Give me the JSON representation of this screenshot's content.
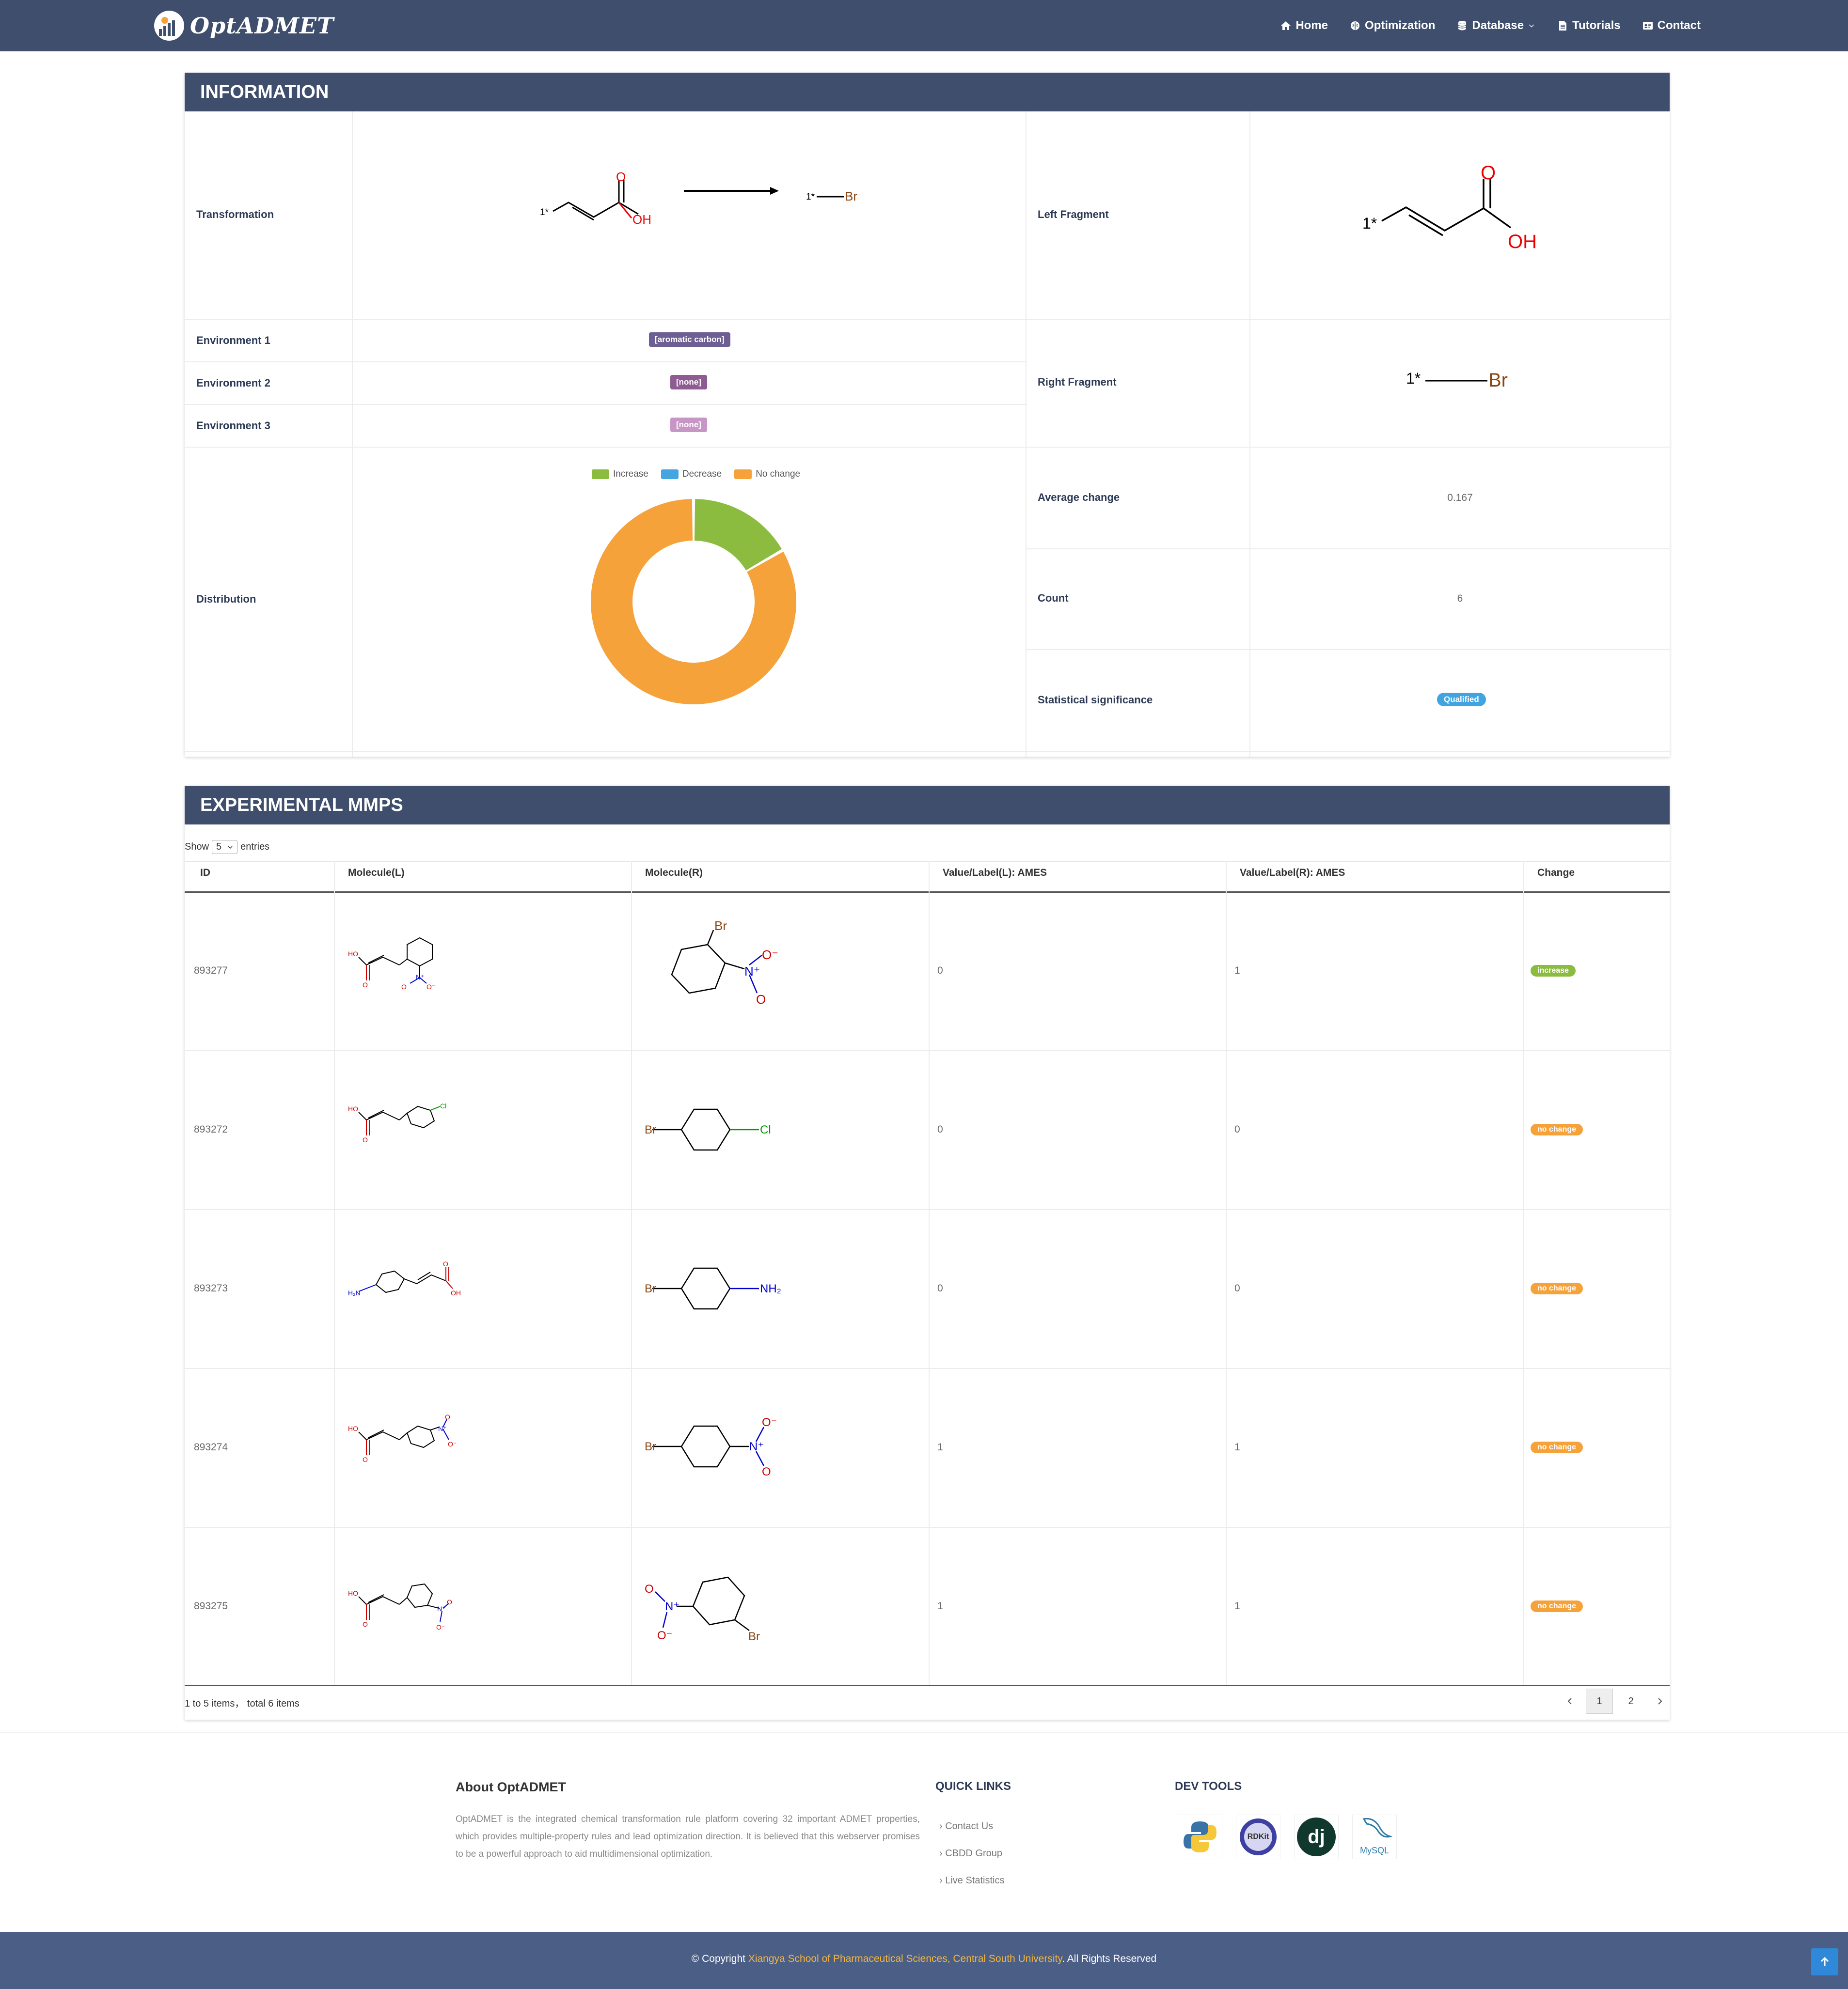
{
  "brand": {
    "name": "OptADMET"
  },
  "nav": {
    "home": "Home",
    "optimization": "Optimization",
    "database": "Database",
    "tutorials": "Tutorials",
    "contact": "Contact"
  },
  "info": {
    "title": "INFORMATION",
    "labels": {
      "transformation": "Transformation",
      "env1": "Environment 1",
      "env2": "Environment 2",
      "env3": "Environment 3",
      "distribution": "Distribution",
      "left_fragment": "Left Fragment",
      "right_fragment": "Right Fragment",
      "average_change": "Average change",
      "count": "Count",
      "significance": "Statistical significance"
    },
    "env1_value": "[aromatic carbon]",
    "env2_value": "[none]",
    "env3_value": "[none]",
    "average_change_value": "0.167",
    "count_value": "6",
    "significance_value": "Qualified",
    "struct": {
      "one_star": "1*",
      "oh": "OH",
      "o": "O",
      "br": "Br"
    },
    "colors": {
      "env1": "#6d5e94",
      "env2": "#8e5c92",
      "env3": "#c896c6",
      "qualified": "#3fa4df"
    }
  },
  "chart_data": {
    "type": "pie",
    "categories": [
      "Increase",
      "Decrease",
      "No change"
    ],
    "values": [
      1,
      0,
      5
    ],
    "colors": [
      "#8bbb3f",
      "#44a5e0",
      "#f6a23b"
    ],
    "legend": "top"
  },
  "mmps": {
    "title": "EXPERIMENTAL MMPS",
    "show_label": "Show",
    "entries_label": "entries",
    "page_size": "5",
    "columns": [
      "ID",
      "Molecule(L)",
      "Molecule(R)",
      "Value/Label(L): AMES",
      "Value/Label(R): AMES",
      "Change"
    ],
    "rows": [
      {
        "id": "893277",
        "l": "0",
        "r": "1",
        "change": "increase"
      },
      {
        "id": "893272",
        "l": "0",
        "r": "0",
        "change": "no change"
      },
      {
        "id": "893273",
        "l": "0",
        "r": "0",
        "change": "no change"
      },
      {
        "id": "893274",
        "l": "1",
        "r": "1",
        "change": "no change"
      },
      {
        "id": "893275",
        "l": "1",
        "r": "1",
        "change": "no change"
      }
    ],
    "atoms": {
      "ho": "HO",
      "oh": "OH",
      "o": "O",
      "o_minus": "O⁻",
      "n_plus": "N⁺",
      "n": "N",
      "cl": "Cl",
      "br": "Br",
      "h2n": "H₂N",
      "nh2": "NH₂"
    },
    "summary": "1 to 5 items， total 6 items",
    "pages": [
      "1",
      "2"
    ]
  },
  "footer": {
    "about_title": "About OptADMET",
    "about_text": "OptADMET is the integrated chemical transformation rule platform covering 32 important ADMET properties, which provides multiple-property rules and lead optimization direction. It is believed that this webserver promises to be a powerful approach to aid multidimensional optimization.",
    "quick_title": "QUICK LINKS",
    "quick_links": [
      "Contact Us",
      "CBDD Group",
      "Live Statistics"
    ],
    "dev_title": "DEV TOOLS",
    "dev_tools": {
      "rdkit": "RDKit",
      "django": "dj",
      "mysql": "MySQL"
    },
    "copyright_pre": "© Copyright",
    "copyright_link": "Xiangya School of Pharmaceutical Sciences, Central South University",
    "copyright_post": ". All Rights Reserved"
  }
}
